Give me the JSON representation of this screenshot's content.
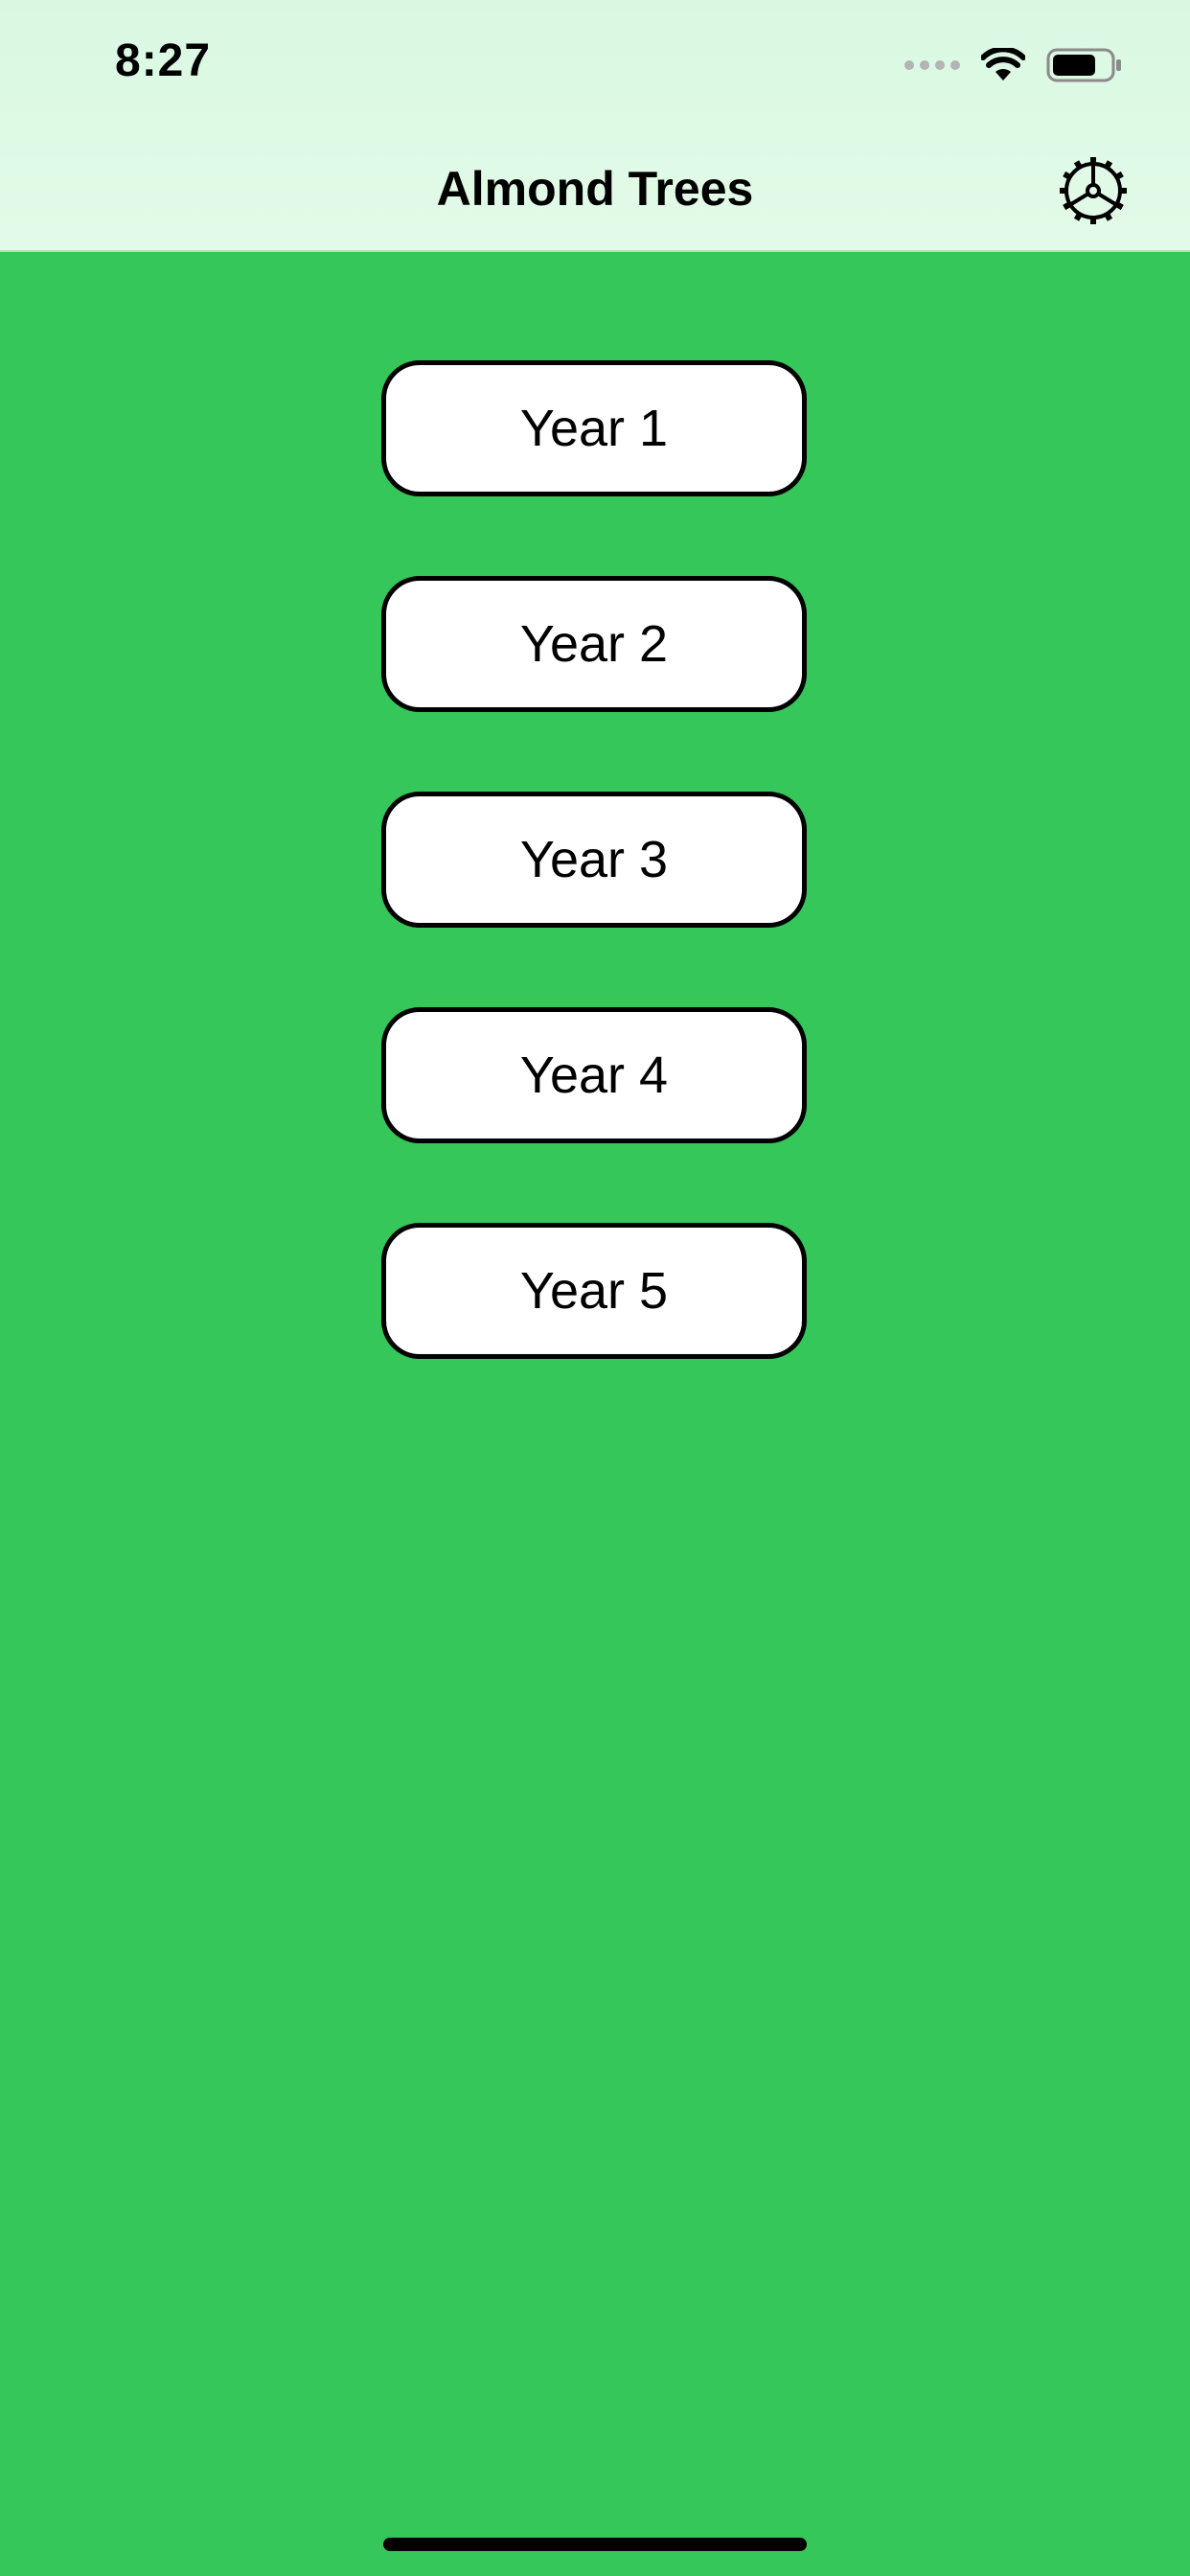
{
  "status_bar": {
    "time": "8:27",
    "icons": [
      "cellular-signal-icon",
      "wifi-icon",
      "battery-icon"
    ],
    "battery_level": 0.75
  },
  "nav": {
    "title": "Almond Trees",
    "settings_icon": "gear-icon"
  },
  "years": [
    {
      "label": "Year 1"
    },
    {
      "label": "Year 2"
    },
    {
      "label": "Year 3"
    },
    {
      "label": "Year 4"
    },
    {
      "label": "Year 5"
    }
  ],
  "colors": {
    "background": "#36c75a",
    "nav_background": "#dffae6",
    "button_background": "#ffffff",
    "button_border": "#000000"
  }
}
